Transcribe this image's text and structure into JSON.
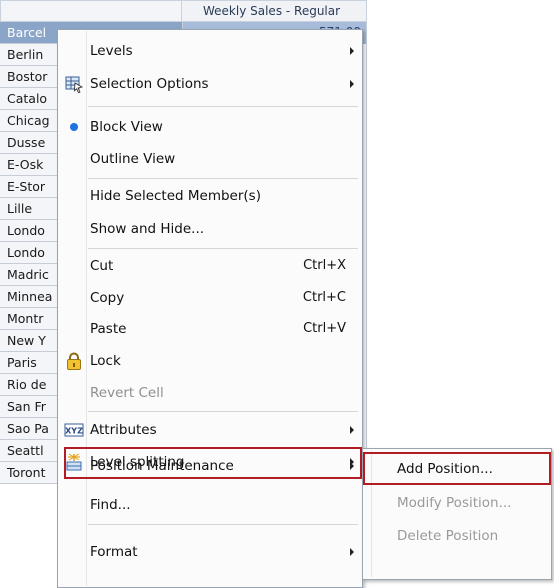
{
  "grid": {
    "column_header": "Weekly Sales - Regular",
    "first_value": "571.00",
    "rows": [
      "Barcel",
      "Berlin",
      "Bostor",
      "Catalo",
      "Chicag",
      "Dusse",
      "E-Osk",
      "E-Stor",
      "Lille",
      "Londo",
      "Londo",
      "Madric",
      "Minnea",
      "Montr",
      "New Y",
      "Paris",
      "Rio de",
      "San Fr",
      "Sao Pa",
      "Seattl",
      "Toront"
    ]
  },
  "menu": {
    "levels": "Levels",
    "selection_options": "Selection Options",
    "block_view": "Block View",
    "outline_view": "Outline View",
    "hide_selected": "Hide Selected Member(s)",
    "show_hide": "Show and Hide...",
    "cut": "Cut",
    "cut_shortcut": "Ctrl+X",
    "copy": "Copy",
    "copy_shortcut": "Ctrl+C",
    "paste": "Paste",
    "paste_shortcut": "Ctrl+V",
    "lock": "Lock",
    "revert_cell": "Revert Cell",
    "attributes": "Attributes",
    "attributes_icon_text": "XYZ",
    "level_splitting": "Level splitting",
    "position_maintenance": "Position Maintenance",
    "find": "Find...",
    "format": "Format"
  },
  "submenu": {
    "add_position": "Add Position...",
    "modify_position": "Modify Position...",
    "delete_position": "Delete Position"
  },
  "colors": {
    "highlight_border": "#b21d24",
    "selected_row": "#8ba5c9",
    "block_view_dot": "#1f73e0"
  },
  "icons": {
    "selection_options": "selection-options-icon",
    "block_view": "radio-dot-icon",
    "lock": "lock-icon",
    "attributes": "xyz-attributes-icon",
    "level_splitting": "level-splitting-icon"
  }
}
